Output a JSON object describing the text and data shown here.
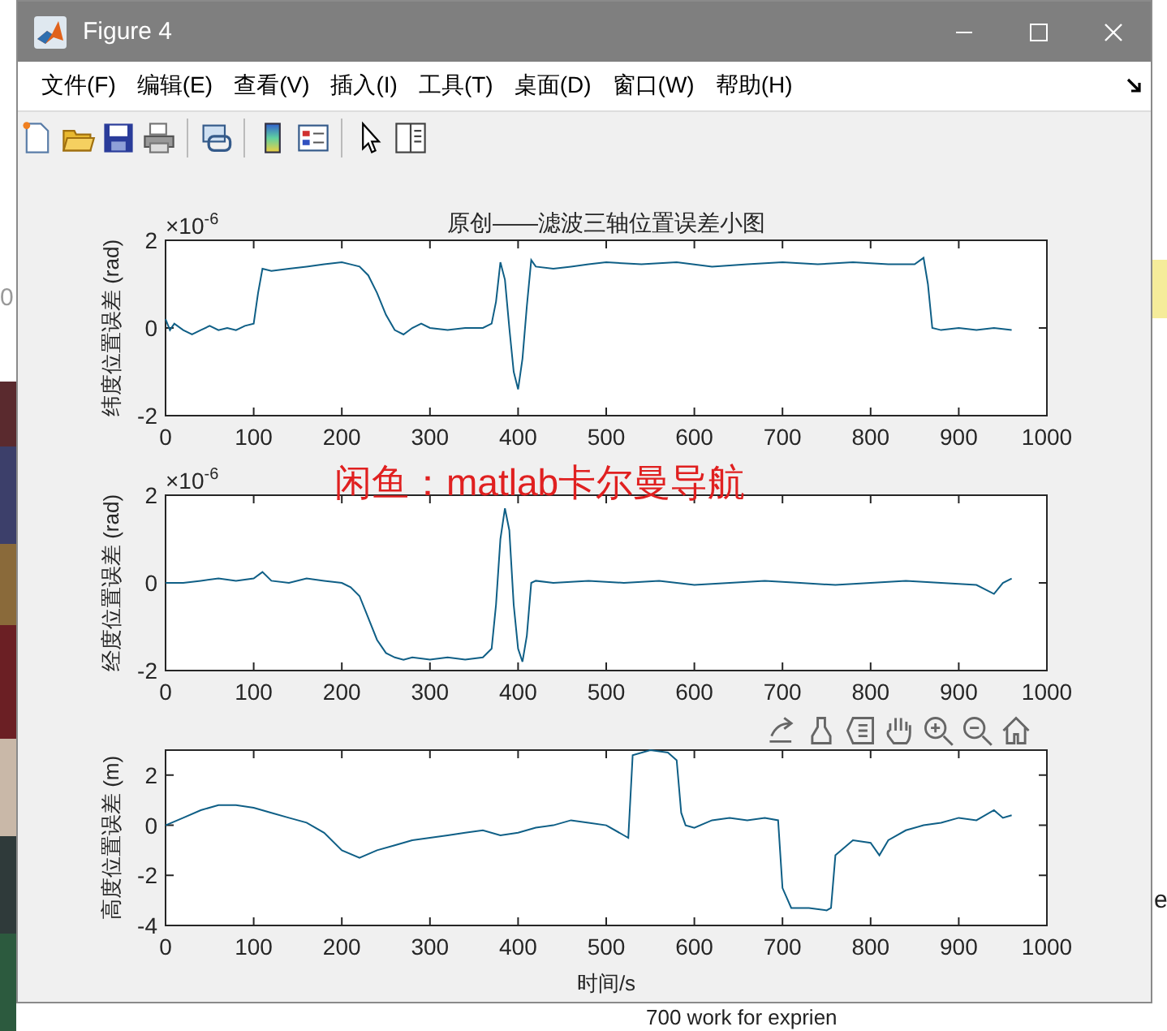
{
  "window": {
    "title": "Figure 4"
  },
  "menu": [
    "文件(F)",
    "编辑(E)",
    "查看(V)",
    "插入(I)",
    "工具(T)",
    "桌面(D)",
    "窗口(W)",
    "帮助(H)"
  ],
  "figure": {
    "overlay_text": "闲鱼：matlab卡尔曼导航",
    "axes": [
      {
        "ylabel": "纬度位置误差 (rad)",
        "multiplier": {
          "base": "×10",
          "exponent": "-6"
        },
        "chart_data": {
          "type": "line",
          "title": "原创——滤波三轴位置误差小图",
          "xlim": [
            0,
            1000
          ],
          "ylim": [
            -2,
            2
          ],
          "xticks": [
            0,
            100,
            200,
            300,
            400,
            500,
            600,
            700,
            800,
            900,
            1000
          ],
          "yticks": [
            -2,
            0,
            2
          ],
          "x": [
            0,
            5,
            10,
            20,
            30,
            40,
            50,
            60,
            70,
            80,
            90,
            100,
            105,
            110,
            120,
            140,
            160,
            180,
            200,
            210,
            220,
            230,
            240,
            250,
            260,
            270,
            280,
            290,
            300,
            320,
            340,
            360,
            370,
            375,
            380,
            385,
            390,
            395,
            400,
            405,
            410,
            415,
            420,
            440,
            460,
            480,
            500,
            540,
            580,
            620,
            660,
            700,
            740,
            780,
            820,
            850,
            860,
            865,
            870,
            880,
            900,
            920,
            940,
            960
          ],
          "series": [
            {
              "color": "#0f5f86",
              "values": [
                0.2,
                -0.05,
                0.1,
                -0.05,
                -0.15,
                -0.05,
                0.05,
                -0.05,
                0.0,
                -0.05,
                0.05,
                0.1,
                0.8,
                1.35,
                1.3,
                1.35,
                1.4,
                1.45,
                1.5,
                1.45,
                1.4,
                1.2,
                0.8,
                0.3,
                -0.05,
                -0.15,
                0.0,
                0.1,
                0.0,
                -0.05,
                0.0,
                0.0,
                0.1,
                0.6,
                1.5,
                1.1,
                0.0,
                -1.0,
                -1.4,
                -0.7,
                0.5,
                1.55,
                1.4,
                1.35,
                1.4,
                1.45,
                1.5,
                1.45,
                1.5,
                1.4,
                1.45,
                1.5,
                1.45,
                1.5,
                1.45,
                1.45,
                1.6,
                1.0,
                0.0,
                -0.05,
                0.0,
                -0.05,
                0.0,
                -0.05
              ]
            }
          ]
        }
      },
      {
        "ylabel": "经度位置误差 (rad)",
        "multiplier": {
          "base": "×10",
          "exponent": "-6"
        },
        "chart_data": {
          "type": "line",
          "xlim": [
            0,
            1000
          ],
          "ylim": [
            -2,
            2
          ],
          "xticks": [
            0,
            100,
            200,
            300,
            400,
            500,
            600,
            700,
            800,
            900,
            1000
          ],
          "yticks": [
            -2,
            0,
            2
          ],
          "x": [
            0,
            20,
            40,
            60,
            80,
            100,
            110,
            120,
            140,
            160,
            180,
            200,
            210,
            220,
            230,
            240,
            250,
            260,
            270,
            280,
            300,
            320,
            340,
            360,
            370,
            375,
            380,
            385,
            390,
            395,
            400,
            405,
            410,
            415,
            420,
            440,
            480,
            520,
            560,
            600,
            640,
            680,
            720,
            760,
            800,
            840,
            880,
            920,
            940,
            950,
            960
          ],
          "series": [
            {
              "color": "#0f5f86",
              "values": [
                0,
                0,
                0.05,
                0.1,
                0.05,
                0.1,
                0.25,
                0.05,
                0.0,
                0.1,
                0.05,
                0.0,
                -0.1,
                -0.3,
                -0.8,
                -1.3,
                -1.6,
                -1.7,
                -1.75,
                -1.7,
                -1.75,
                -1.7,
                -1.75,
                -1.7,
                -1.5,
                -0.5,
                1.0,
                1.7,
                1.2,
                -0.5,
                -1.5,
                -1.8,
                -1.2,
                0.0,
                0.05,
                0.0,
                0.05,
                0.0,
                0.05,
                -0.05,
                0.0,
                0.05,
                0.0,
                -0.05,
                0.0,
                0.05,
                0.0,
                -0.05,
                -0.25,
                0.0,
                0.1
              ]
            }
          ]
        }
      },
      {
        "ylabel": "高度位置误差 (m)",
        "chart_data": {
          "type": "line",
          "xlabel": "时间/s",
          "xlim": [
            0,
            1000
          ],
          "ylim": [
            -4,
            3
          ],
          "xticks": [
            0,
            100,
            200,
            300,
            400,
            500,
            600,
            700,
            800,
            900,
            1000
          ],
          "yticks": [
            -4,
            -2,
            0,
            2
          ],
          "x": [
            0,
            20,
            40,
            60,
            80,
            100,
            120,
            140,
            160,
            180,
            200,
            220,
            240,
            260,
            280,
            300,
            320,
            340,
            360,
            380,
            400,
            420,
            440,
            460,
            480,
            500,
            520,
            525,
            530,
            550,
            570,
            580,
            585,
            590,
            600,
            620,
            640,
            660,
            680,
            695,
            700,
            710,
            730,
            750,
            755,
            760,
            780,
            800,
            810,
            820,
            840,
            860,
            880,
            900,
            920,
            940,
            950,
            960
          ],
          "series": [
            {
              "color": "#0f5f86",
              "values": [
                0,
                0.3,
                0.6,
                0.8,
                0.8,
                0.7,
                0.5,
                0.3,
                0.1,
                -0.3,
                -1.0,
                -1.3,
                -1.0,
                -0.8,
                -0.6,
                -0.5,
                -0.4,
                -0.3,
                -0.2,
                -0.4,
                -0.3,
                -0.1,
                0.0,
                0.2,
                0.1,
                0.0,
                -0.4,
                -0.5,
                2.8,
                3.0,
                2.9,
                2.6,
                0.5,
                0.0,
                -0.1,
                0.2,
                0.3,
                0.2,
                0.3,
                0.2,
                -2.5,
                -3.3,
                -3.3,
                -3.4,
                -3.3,
                -1.2,
                -0.6,
                -0.7,
                -1.2,
                -0.6,
                -0.2,
                0.0,
                0.1,
                0.3,
                0.2,
                0.6,
                0.3,
                0.4
              ]
            }
          ]
        }
      }
    ]
  },
  "backdrop": {
    "left_text": "0",
    "right_texts": [
      "e"
    ],
    "bottom_text": "700 work for exprien"
  }
}
